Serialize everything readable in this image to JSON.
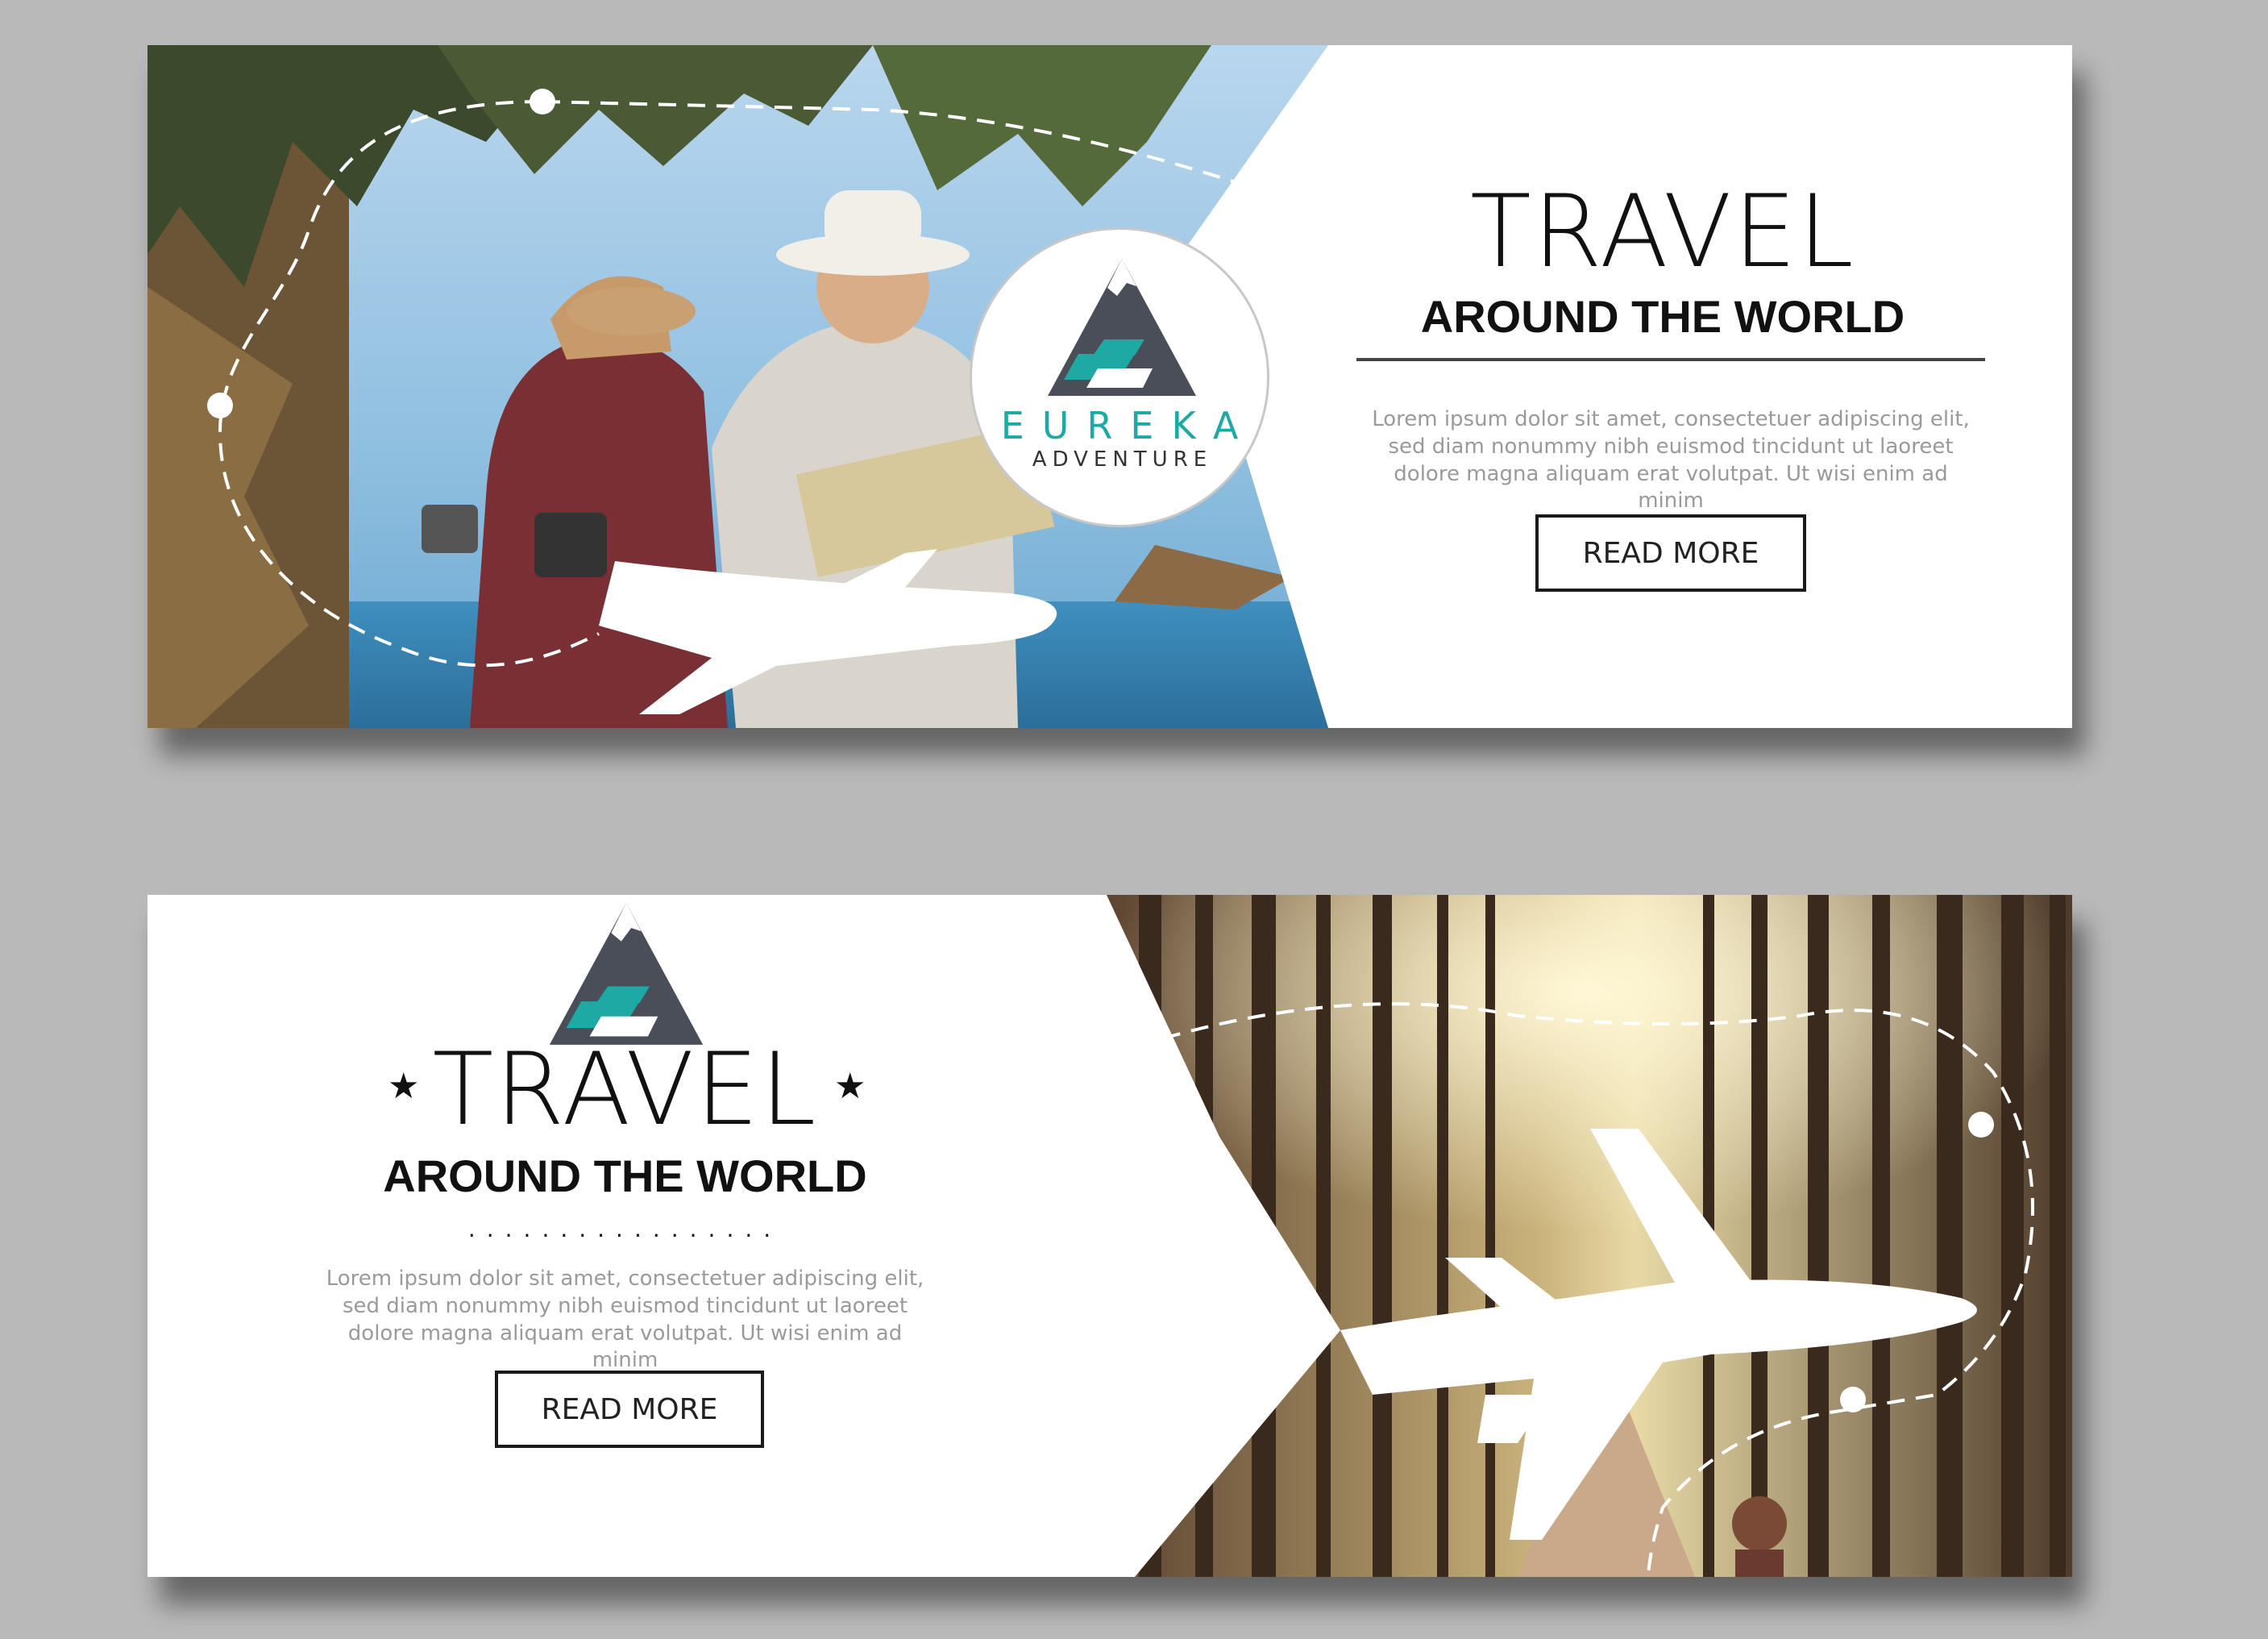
{
  "banners": [
    {
      "logo": {
        "name": "EUREKA",
        "sub": "ADVENTURE"
      },
      "title": "TRAVEL",
      "subtitle": "AROUND THE WORLD",
      "body": "Lorem ipsum dolor sit amet, consectetuer adipiscing elit, sed diam nonummy nibh euismod tincidunt ut laoreet dolore magna aliquam erat volutpat. Ut wisi enim ad minim",
      "button": "READ MORE"
    },
    {
      "title": "TRAVEL",
      "subtitle": "AROUND THE WORLD",
      "body": "Lorem ipsum dolor sit amet, consectetuer adipiscing elit, sed diam nonummy nibh euismod tincidunt ut laoreet dolore magna aliquam erat volutpat. Ut wisi enim ad minim",
      "button": "READ MORE"
    }
  ],
  "colors": {
    "teal": "#1ea9a4",
    "slate": "#4a4e58",
    "text": "#111111",
    "muted": "#9a9a9a",
    "backdrop": "#b9b9b9"
  },
  "icons": [
    "mountain-logo-icon",
    "airplane-icon",
    "star-icon",
    "dashed-flight-path"
  ]
}
